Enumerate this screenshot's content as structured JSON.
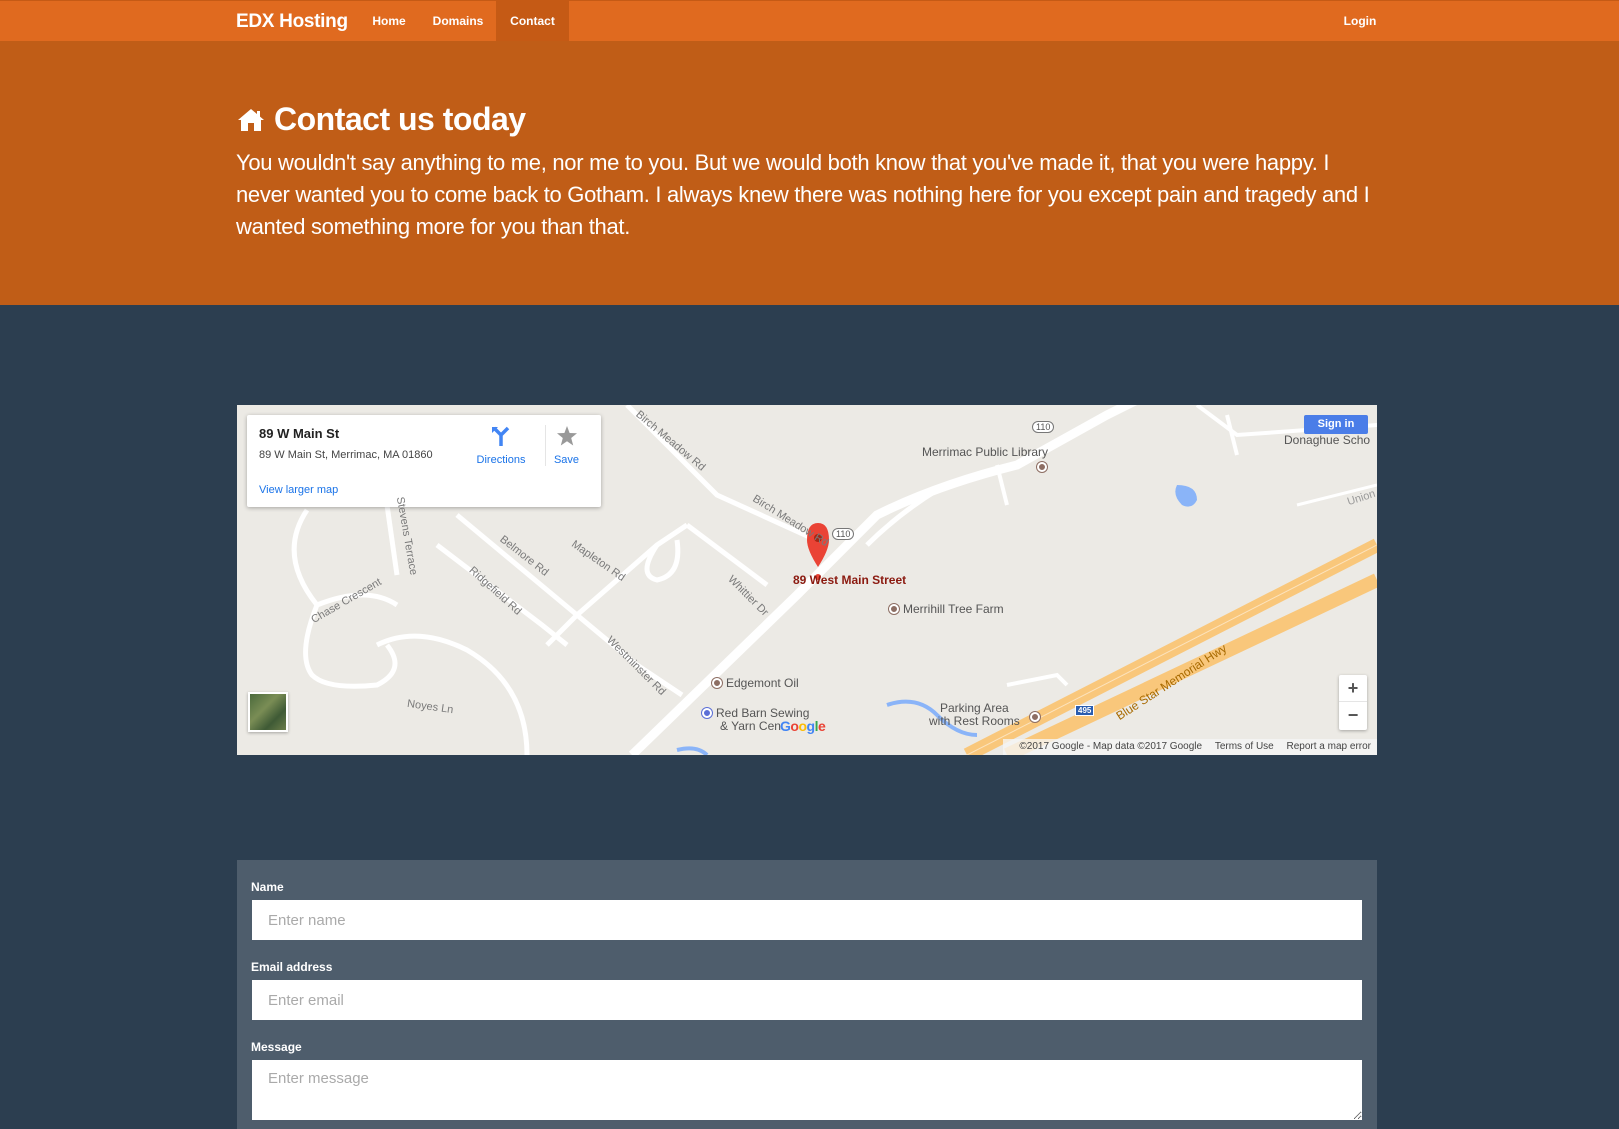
{
  "brand": "EDX Hosting",
  "nav": {
    "items": [
      {
        "label": "Home"
      },
      {
        "label": "Domains"
      },
      {
        "label": "Contact",
        "active": true
      }
    ],
    "login": "Login"
  },
  "hero": {
    "icon": "home-icon",
    "title": "Contact us today",
    "text": "You wouldn't say anything to me, nor me to you. But we would both know that you've made it, that you were happy. I never wanted you to come back to Gotham. I always knew there was nothing here for you except pain and tragedy and I wanted something more for you than that."
  },
  "map": {
    "card": {
      "title": "89 W Main St",
      "address": "89 W Main St, Merrimac, MA 01860",
      "directions": "Directions",
      "save": "Save",
      "view_larger": "View larger map"
    },
    "marker_label": "89 West Main Street",
    "sign_in": "Sign in",
    "zoom_in": "+",
    "zoom_out": "−",
    "labels": {
      "library": "Merrimac Public Library",
      "school": "Donaghue Scho",
      "union": "Union",
      "farm": "Merrihill Tree Farm",
      "edgemont": "Edgemont Oil",
      "redbarn_1": "Red Barn Sewing",
      "redbarn_2": "& Yarn Cen",
      "parking_1": "Parking Area",
      "parking_2": "with Rest Rooms",
      "birch1": "Birch Meadow Rd",
      "birch2": "Birch Meadow Rd",
      "belmore": "Belmore Rd",
      "mapleton": "Mapleton Rd",
      "ridgefield": "Ridgefield Rd",
      "whittier": "Whittier Dr",
      "westminster": "Westminster Rd",
      "chase": "Chase Crescent",
      "stevens": "Stevens Terrace",
      "noyes": "Noyes Ln",
      "bluestar": "Blue Star Memorial Hwy",
      "route110": "110",
      "route495": "495",
      "google": "Google"
    },
    "footer": {
      "copyright": "©2017 Google - Map data ©2017 Google",
      "terms": "Terms of Use",
      "report": "Report a map error"
    }
  },
  "form": {
    "name_label": "Name",
    "name_placeholder": "Enter name",
    "email_label": "Email address",
    "email_placeholder": "Enter email",
    "message_label": "Message",
    "message_placeholder": "Enter message"
  },
  "colors": {
    "navbar": "#e06a1f",
    "hero": "#c05d17",
    "background": "#2c3e50",
    "form_panel": "#4e5d6c"
  }
}
